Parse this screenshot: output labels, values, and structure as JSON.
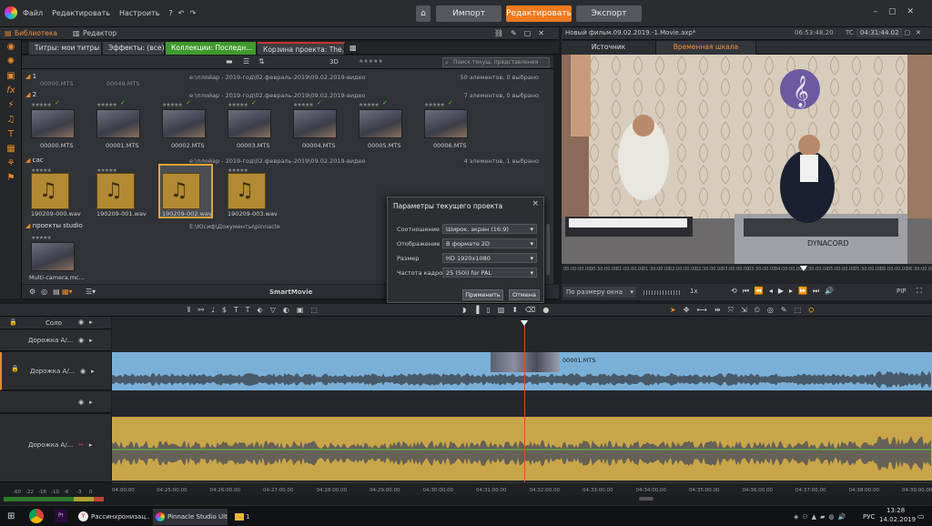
{
  "menu": {
    "file": "Файл",
    "edit": "Редактировать",
    "settings": "Настроить"
  },
  "modes": {
    "import": "Импорт",
    "edit": "Редактировать",
    "export": "Экспорт"
  },
  "library_header": {
    "library": "Библиотека",
    "editor": "Редактор"
  },
  "library_tabs": [
    "Титры: мои титры",
    "Эффекты: (все)",
    "Коллекции: Последн...",
    "Корзина проекта: The..."
  ],
  "project": {
    "title": "Новый фильм.09.02.2019.-1.Movie.axp*",
    "duration": "06:53:48.20",
    "tc": "TC",
    "timecode": "04:31:44.02"
  },
  "preview_tabs": {
    "source": "Источник",
    "timeline": "Временная шкала"
  },
  "library_toolbar": {
    "mode_3d": "3D",
    "stars": "★★★★★",
    "search_placeholder": "Поиск текущ. представления"
  },
  "groups": [
    {
      "name": "1",
      "path": "e:\\плойар - 2019-год\\02.февраль-2019\\09.02.2019-видео",
      "count": "50 элементов, 0 выбрано"
    },
    {
      "name": "2",
      "path": "e:\\плойар - 2019-год\\02.февраль-2019\\09.02.2019-видео",
      "count": "7 элементов, 0 выбрано"
    },
    {
      "name": "сас",
      "path": "e:\\плойар - 2019-год\\02.февраль-2019\\09.02.2019-видео",
      "count": "4 элементов, 1 выбрано"
    },
    {
      "name": "проекты studio",
      "path": "E:\\Юсиф\\Документы\\pinnacle",
      "count": ""
    }
  ],
  "group1_partial": [
    "00000.MTS",
    "00049.MTS"
  ],
  "video_clips": [
    "00000.MTS",
    "00001.MTS",
    "00002.MTS",
    "00003.MTS",
    "00004.MTS",
    "00005.MTS",
    "00006.MTS"
  ],
  "audio_clips": [
    "190209-000.wav",
    "190209-001.wav",
    "190209-002.wav",
    "190209-003.wav"
  ],
  "studio_projects": [
    "Multi-camera.mc..."
  ],
  "library_footer": {
    "smartmovie": "SmartMovie"
  },
  "dialog": {
    "title": "Параметры текущего проекта",
    "close": "×",
    "rows": [
      {
        "label": "Соотношение",
        "value": "Широк. экран (16:9)"
      },
      {
        "label": "Отображение",
        "value": "В формате 2D"
      },
      {
        "label": "Размер",
        "value": "HD 1920x1080"
      },
      {
        "label": "Частота кадров",
        "value": "25 (50i) for PAL"
      }
    ],
    "apply": "Применить",
    "cancel": "Отмена"
  },
  "preview_scrub": [
    "00:00:00.00",
    "00:30:00.00",
    "01:00:00.00",
    "01:30:00.00",
    "02:00:00.00",
    "02:30:00.00",
    "03:00:00.00",
    "03:30:00.00",
    "04:00:00.00",
    "04:30:00.00",
    "05:00:00.00",
    "05:30:00.00",
    "06:00:00.00",
    "06:30:00.00"
  ],
  "preview_controls": {
    "fit": "По размеру окна",
    "speed": "1x",
    "pip": "PIP"
  },
  "tracks": [
    {
      "name": "Соло"
    },
    {
      "name": "Дорожка А/..."
    },
    {
      "name": "Дорожка А/..."
    },
    {
      "name": "Дорожка А/..."
    }
  ],
  "timeline_clip": "00001.MTS",
  "ruler": [
    "04:00:00",
    "04:25:00.00",
    "04:26:00.00",
    "04:27:00.00",
    "04:28:00.00",
    "04:29:00.00",
    "04:30:00.00",
    "04:31:00.00",
    "04:32:00.00",
    "04:33:00.00",
    "04:34:00.00",
    "04:35:00.00",
    "04:36:00.00",
    "04:37:00.00",
    "04:38:00.00",
    "04:39:00.00"
  ],
  "meter": [
    "-60",
    "-22",
    "-16",
    "-10",
    "-6",
    "-3",
    "0"
  ],
  "taskbar": {
    "browser_tab": "Рассинхронизац...",
    "pinnacle": "Pinnacle Studio Ulti...",
    "folder_count": "1",
    "lang": "РУС",
    "time": "13:28",
    "date": "14.02.2019"
  },
  "colors": {
    "accent": "#f07a1e",
    "green_tab": "#3f9a2c",
    "video_track": "#7ab0d8",
    "audio_track": "#c9a54a"
  }
}
